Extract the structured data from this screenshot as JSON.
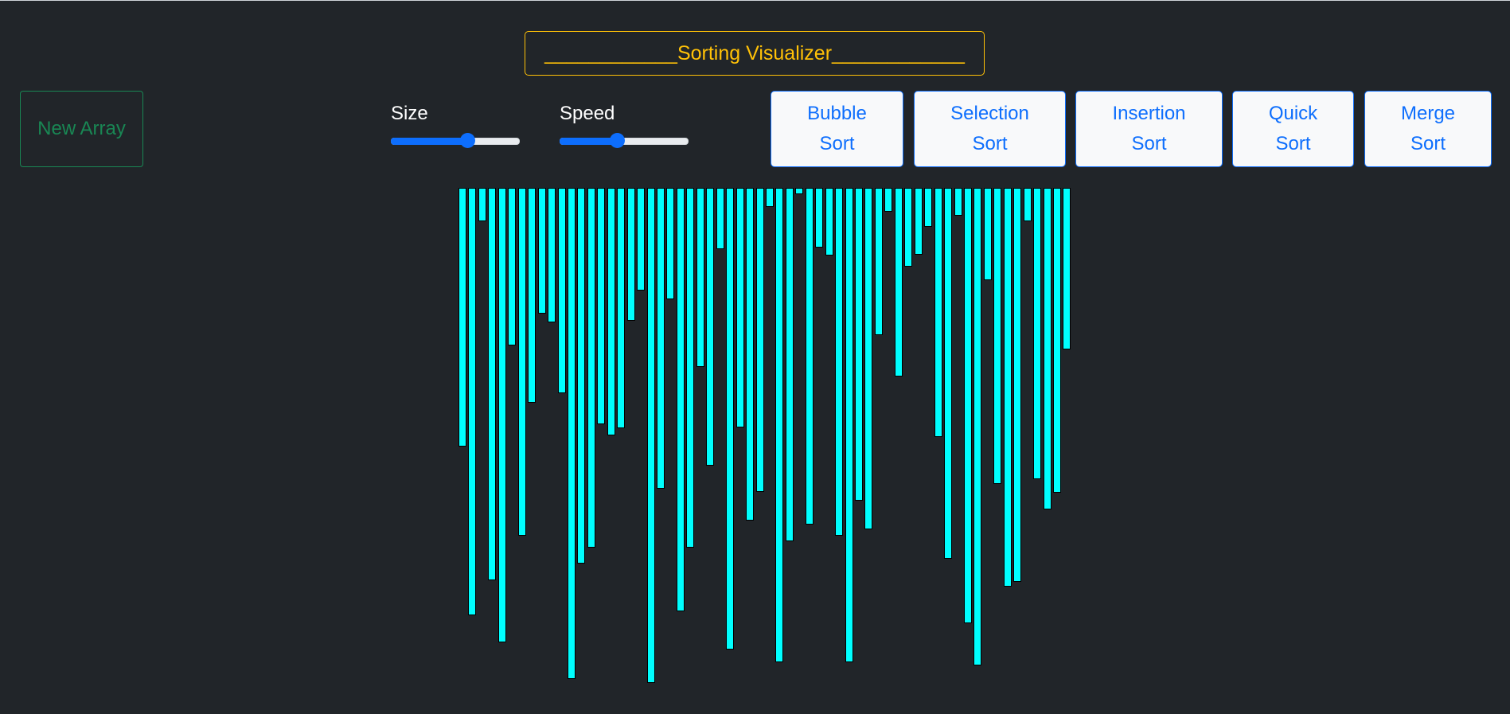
{
  "title": "____________Sorting Visualizer____________",
  "new_array_label": "New Array",
  "sliders": [
    {
      "label": "Size",
      "value": 0.6
    },
    {
      "label": "Speed",
      "value": 0.45
    }
  ],
  "sort_buttons": [
    {
      "line1": "Bubble",
      "line2": "Sort"
    },
    {
      "line1": "Selection",
      "line2": "Sort"
    },
    {
      "line1": "Insertion",
      "line2": "Sort"
    },
    {
      "line1": "Quick",
      "line2": "Sort"
    },
    {
      "line1": "Merge",
      "line2": "Sort"
    }
  ],
  "array_values": [
    325,
    537,
    42,
    493,
    571,
    198,
    437,
    270,
    158,
    169,
    258,
    617,
    472,
    452,
    297,
    311,
    302,
    167,
    129,
    622,
    378,
    140,
    532,
    452,
    225,
    349,
    77,
    580,
    301,
    418,
    382,
    24,
    596,
    444,
    8,
    423,
    75,
    85,
    437,
    596,
    393,
    429,
    185,
    30,
    237,
    99,
    84,
    49,
    313,
    466,
    35,
    547,
    600,
    116,
    372,
    501,
    495,
    42,
    366,
    404,
    383,
    203
  ],
  "colors": {
    "background": "#212529",
    "bar": "#00ffff",
    "title": "#ffc107",
    "new_array": "#198754",
    "accent": "#0d6efd"
  }
}
